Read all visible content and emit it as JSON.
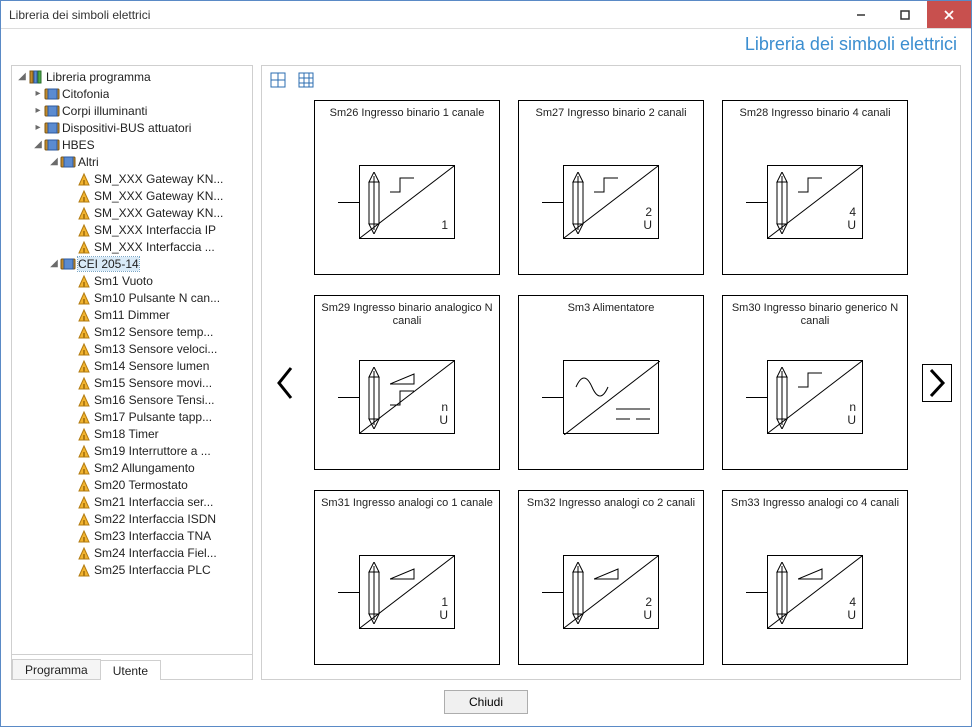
{
  "window": {
    "title": "Libreria dei simboli elettrici"
  },
  "header": {
    "libtitle": "Libreria dei simboli elettrici"
  },
  "tabs": {
    "programma": "Programma",
    "utente": "Utente"
  },
  "footer": {
    "close": "Chiudi"
  },
  "tree": {
    "root": "Libreria programma",
    "n_citofonia": "Citofonia",
    "n_corpi": "Corpi illuminanti",
    "n_disp": "Dispositivi-BUS attuatori",
    "n_hbes": "HBES",
    "n_altri": "Altri",
    "altri_items": [
      "SM_XXX Gateway KN...",
      "SM_XXX Gateway KN...",
      "SM_XXX Gateway KN...",
      "SM_XXX Interfaccia IP",
      "SM_XXX Interfaccia ..."
    ],
    "n_cei": "CEI 205-14",
    "cei_items": [
      "Sm1 Vuoto",
      "Sm10 Pulsante N can...",
      "Sm11 Dimmer",
      "Sm12 Sensore temp...",
      "Sm13 Sensore veloci...",
      "Sm14 Sensore lumen",
      "Sm15 Sensore movi...",
      "Sm16 Sensore Tensi...",
      "Sm17 Pulsante tapp...",
      "Sm18 Timer",
      "Sm19 Interruttore a ...",
      "Sm2 Allungamento",
      "Sm20 Termostato",
      "Sm21 Interfaccia ser...",
      "Sm22 Interfaccia ISDN",
      "Sm23 Interfaccia TNA",
      "Sm24 Interfaccia Fiel...",
      "Sm25 Interfaccia PLC"
    ]
  },
  "cards": [
    {
      "title": "Sm26 Ingresso binario  1 canale",
      "rb": "1",
      "type": "step"
    },
    {
      "title": "Sm27 Ingresso binario  2 canali",
      "rb": "2\nU",
      "type": "step"
    },
    {
      "title": "Sm28 Ingresso binario  4 canali",
      "rb": "4\nU",
      "type": "step"
    },
    {
      "title": "Sm29 Ingresso binario analogico N canali",
      "rb": "n\nU",
      "type": "step_tri"
    },
    {
      "title": "Sm3 Alimentatore",
      "rb": "",
      "type": "psu"
    },
    {
      "title": "Sm30 Ingresso binario generico N canali",
      "rb": "n\nU",
      "type": "step"
    },
    {
      "title": "Sm31 Ingresso analogi co 1 canale",
      "rb": "1\nU",
      "type": "tri"
    },
    {
      "title": "Sm32 Ingresso analogi co 2 canali",
      "rb": "2\nU",
      "type": "tri"
    },
    {
      "title": "Sm33 Ingresso analogi co 4 canali",
      "rb": "4\nU",
      "type": "tri"
    }
  ]
}
